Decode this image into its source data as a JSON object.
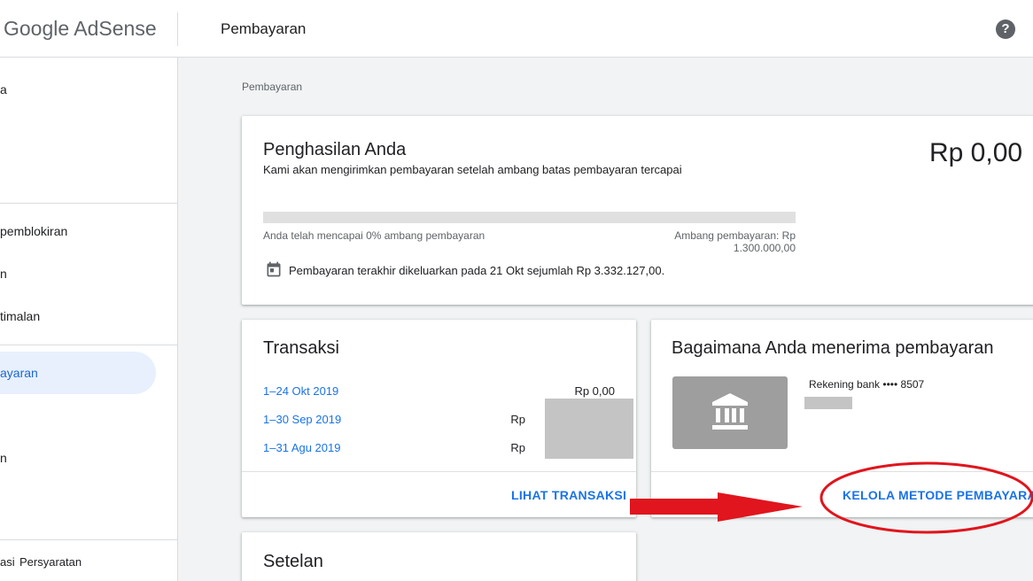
{
  "header": {
    "logo": "Google AdSense",
    "title": "Pembayaran",
    "help_icon": "help-circle-icon"
  },
  "sidebar": {
    "items": [
      {
        "label": "a"
      },
      {
        "label": " pemblokiran"
      },
      {
        "label": "n"
      },
      {
        "label": "timalan"
      },
      {
        "label": "ayaran"
      },
      {
        "label": "n"
      }
    ],
    "footer": {
      "privacy": "asi",
      "terms": "Persyaratan"
    }
  },
  "breadcrumb": "Pembayaran",
  "earnings": {
    "title": "Penghasilan Anda",
    "amount": "Rp 0,00",
    "description": "Kami akan mengirimkan pembayaran setelah ambang batas pembayaran tercapai",
    "progress_percent": 0,
    "progress_left": "Anda telah mencapai 0% ambang pembayaran",
    "progress_right": "Ambang pembayaran: Rp 1.300.000,00",
    "last_payment": "Pembayaran terakhir dikeluarkan pada 21 Okt sejumlah Rp 3.332.127,00."
  },
  "transactions": {
    "title": "Transaksi",
    "rows": [
      {
        "date": "1–24 Okt 2019",
        "amount": "Rp 0,00"
      },
      {
        "date": "1–30 Sep 2019",
        "amount": "Rp"
      },
      {
        "date": "1–31 Agu 2019",
        "amount": "Rp"
      }
    ],
    "action": "LIHAT TRANSAKSI"
  },
  "payment_method": {
    "title": "Bagaimana Anda menerima pembayaran",
    "bank_label": "Rekening bank •••• 8507",
    "action": "KELOLA METODE PEMBAYARAN"
  },
  "settings": {
    "title": "Setelan"
  },
  "colors": {
    "link": "#1a73e8",
    "nav_active_bg": "#e8f0fe",
    "annotation": "#e0151d"
  }
}
